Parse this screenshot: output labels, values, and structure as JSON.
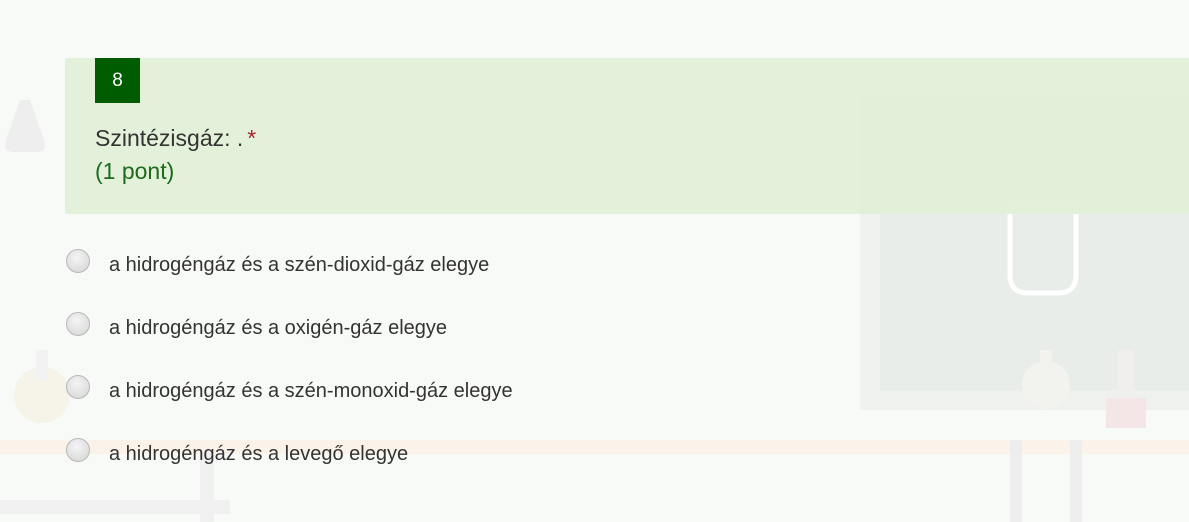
{
  "question": {
    "number": "8",
    "title": "Szintézisgáz: .",
    "required_mark": "*",
    "points": "(1 pont)"
  },
  "options": [
    {
      "label": "a hidrogéngáz és a szén-dioxid-gáz elegye",
      "selected": false
    },
    {
      "label": "a hidrogéngáz és a oxigén-gáz elegye",
      "selected": false
    },
    {
      "label": "a hidrogéngáz és a szén-monoxid-gáz elegye",
      "selected": false
    },
    {
      "label": "a hidrogéngáz és a levegő elegye",
      "selected": false
    }
  ],
  "colors": {
    "number_badge": "#005c00",
    "card_background": "#e2f0d7",
    "points_text": "#1e6b1e",
    "required_mark": "#a4262c"
  }
}
